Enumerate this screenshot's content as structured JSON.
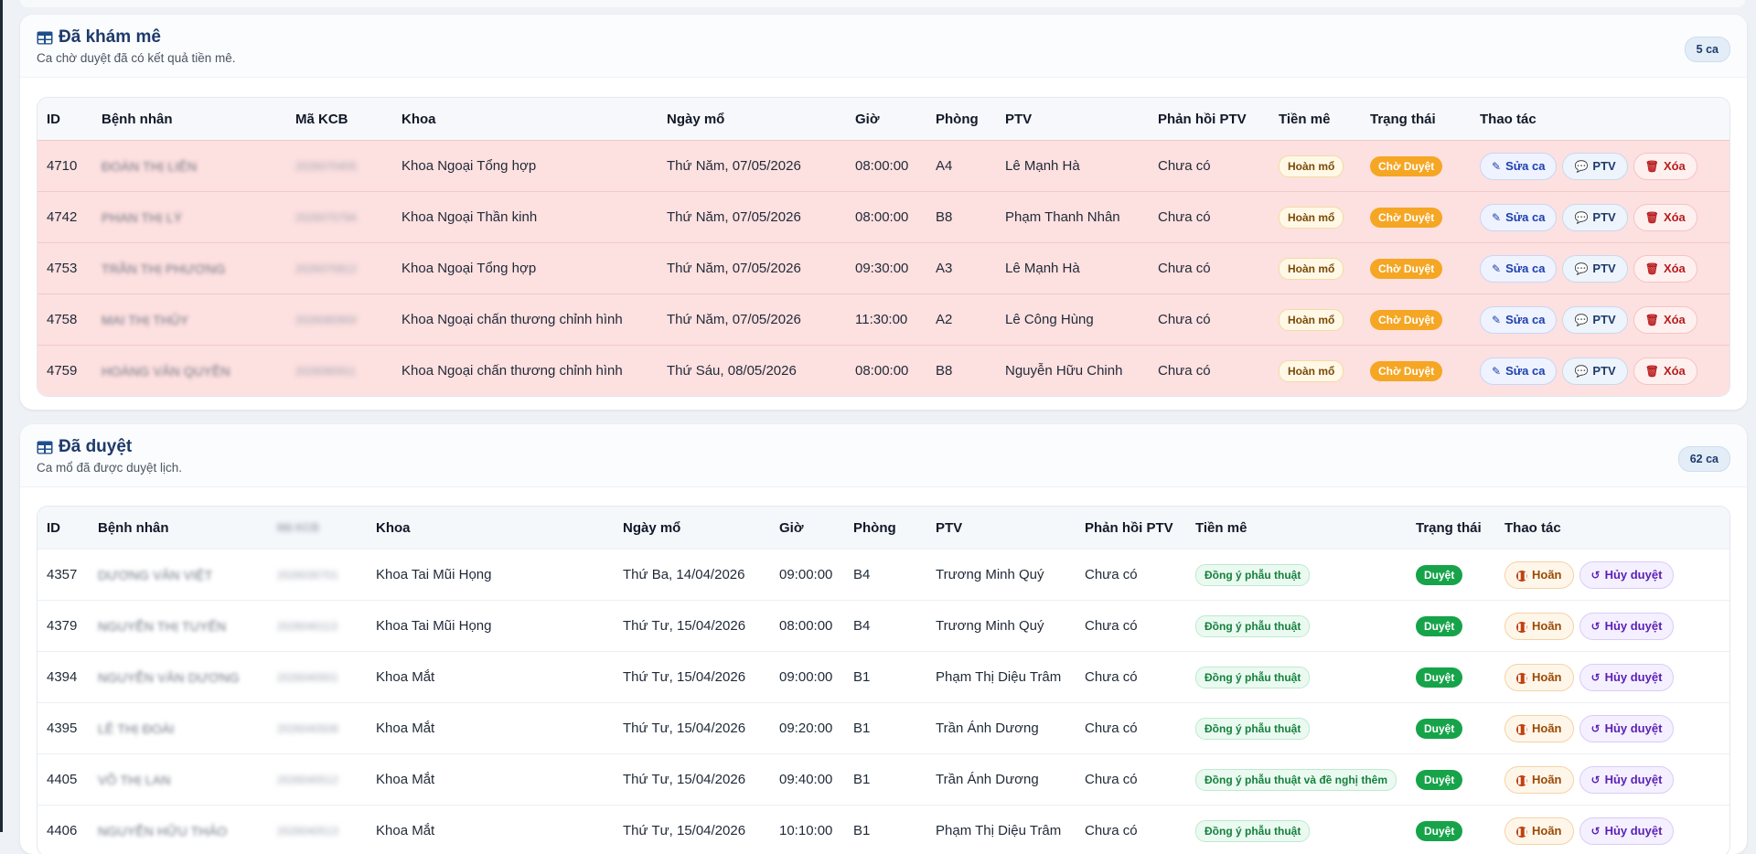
{
  "section_pending": {
    "title": "Đã khám mê",
    "subtitle": "Ca chờ duyệt đã có kết quả tiền mê.",
    "count": "5 ca",
    "headers": [
      "ID",
      "Bệnh nhân",
      "Mã KCB",
      "Khoa",
      "Ngày mổ",
      "Giờ",
      "Phòng",
      "PTV",
      "Phản hồi PTV",
      "Tiền mê",
      "Trạng thái",
      "Thao tác"
    ],
    "actions": {
      "edit": "Sửa ca",
      "ptv": "PTV",
      "delete": "Xóa"
    },
    "rows": [
      {
        "id": "4710",
        "patient": "ĐOÀN THỊ LIÊN",
        "code": "2026070405",
        "dept": "Khoa Ngoại Tổng hợp",
        "date": "Thứ Năm, 07/05/2026",
        "time": "08:00:00",
        "room": "A4",
        "ptv": "Lê Mạnh Hà",
        "feedback": "Chưa có",
        "anes": "Hoàn mổ",
        "status": "Chờ Duyệt"
      },
      {
        "id": "4742",
        "patient": "PHAN THỊ LÝ",
        "code": "2026070794",
        "dept": "Khoa Ngoại Thần kinh",
        "date": "Thứ Năm, 07/05/2026",
        "time": "08:00:00",
        "room": "B8",
        "ptv": "Phạm Thanh Nhân",
        "feedback": "Chưa có",
        "anes": "Hoàn mổ",
        "status": "Chờ Duyệt"
      },
      {
        "id": "4753",
        "patient": "TRẦN THỊ PHƯƠNG",
        "code": "2026070812",
        "dept": "Khoa Ngoại Tổng hợp",
        "date": "Thứ Năm, 07/05/2026",
        "time": "09:30:00",
        "room": "A3",
        "ptv": "Lê Mạnh Hà",
        "feedback": "Chưa có",
        "anes": "Hoàn mổ",
        "status": "Chờ Duyệt"
      },
      {
        "id": "4758",
        "patient": "MAI THỊ THỦY",
        "code": "2026080900",
        "dept": "Khoa Ngoại chấn thương chỉnh hình",
        "date": "Thứ Năm, 07/05/2026",
        "time": "11:30:00",
        "room": "A2",
        "ptv": "Lê Công Hùng",
        "feedback": "Chưa có",
        "anes": "Hoàn mổ",
        "status": "Chờ Duyệt"
      },
      {
        "id": "4759",
        "patient": "HOÀNG VĂN QUYỀN",
        "code": "2026080911",
        "dept": "Khoa Ngoại chấn thương chỉnh hình",
        "date": "Thứ Sáu, 08/05/2026",
        "time": "08:00:00",
        "room": "B8",
        "ptv": "Nguyễn Hữu Chinh",
        "feedback": "Chưa có",
        "anes": "Hoàn mổ",
        "status": "Chờ Duyệt"
      }
    ]
  },
  "section_approved": {
    "title": "Đã duyệt",
    "subtitle": "Ca mổ đã được duyệt lịch.",
    "count": "62 ca",
    "headers": [
      "ID",
      "Bệnh nhân",
      "Mã KCB",
      "Khoa",
      "Ngày mổ",
      "Giờ",
      "Phòng",
      "PTV",
      "Phản hồi PTV",
      "Tiền mê",
      "Trạng thái",
      "Thao tác"
    ],
    "actions": {
      "postpone": "Hoãn",
      "cancel": "Hủy duyệt"
    },
    "rows": [
      {
        "id": "4357",
        "patient": "DƯƠNG VĂN VIỆT",
        "code": "2026030701",
        "dept": "Khoa Tai Mũi Họng",
        "date": "Thứ Ba, 14/04/2026",
        "time": "09:00:00",
        "room": "B4",
        "ptv": "Trương Minh Quý",
        "feedback": "Chưa có",
        "anes": "Đồng ý phẫu thuật",
        "status": "Duyệt"
      },
      {
        "id": "4379",
        "patient": "NGUYỄN THỊ TUYẾN",
        "code": "2026040113",
        "dept": "Khoa Tai Mũi Họng",
        "date": "Thứ Tư, 15/04/2026",
        "time": "08:00:00",
        "room": "B4",
        "ptv": "Trương Minh Quý",
        "feedback": "Chưa có",
        "anes": "Đồng ý phẫu thuật",
        "status": "Duyệt"
      },
      {
        "id": "4394",
        "patient": "NGUYỄN VĂN DƯƠNG",
        "code": "2026040501",
        "dept": "Khoa Mắt",
        "date": "Thứ Tư, 15/04/2026",
        "time": "09:00:00",
        "room": "B1",
        "ptv": "Phạm Thị Diệu Trâm",
        "feedback": "Chưa có",
        "anes": "Đồng ý phẫu thuật",
        "status": "Duyệt"
      },
      {
        "id": "4395",
        "patient": "LÊ THỊ ĐOÀI",
        "code": "2026040508",
        "dept": "Khoa Mắt",
        "date": "Thứ Tư, 15/04/2026",
        "time": "09:20:00",
        "room": "B1",
        "ptv": "Trần Ánh Dương",
        "feedback": "Chưa có",
        "anes": "Đồng ý phẫu thuật",
        "status": "Duyệt"
      },
      {
        "id": "4405",
        "patient": "VÕ THỊ LAN",
        "code": "2026040512",
        "dept": "Khoa Mắt",
        "date": "Thứ Tư, 15/04/2026",
        "time": "09:40:00",
        "room": "B1",
        "ptv": "Trần Ánh Dương",
        "feedback": "Chưa có",
        "anes": "Đồng ý phẫu thuật và đề nghị thêm",
        "status": "Duyệt"
      },
      {
        "id": "4406",
        "patient": "NGUYỄN HỮU THẢO",
        "code": "2026040513",
        "dept": "Khoa Mắt",
        "date": "Thứ Tư, 15/04/2026",
        "time": "10:10:00",
        "room": "B1",
        "ptv": "Phạm Thị Diệu Trâm",
        "feedback": "Chưa có",
        "anes": "Đồng ý phẫu thuật",
        "status": "Duyệt"
      }
    ]
  }
}
